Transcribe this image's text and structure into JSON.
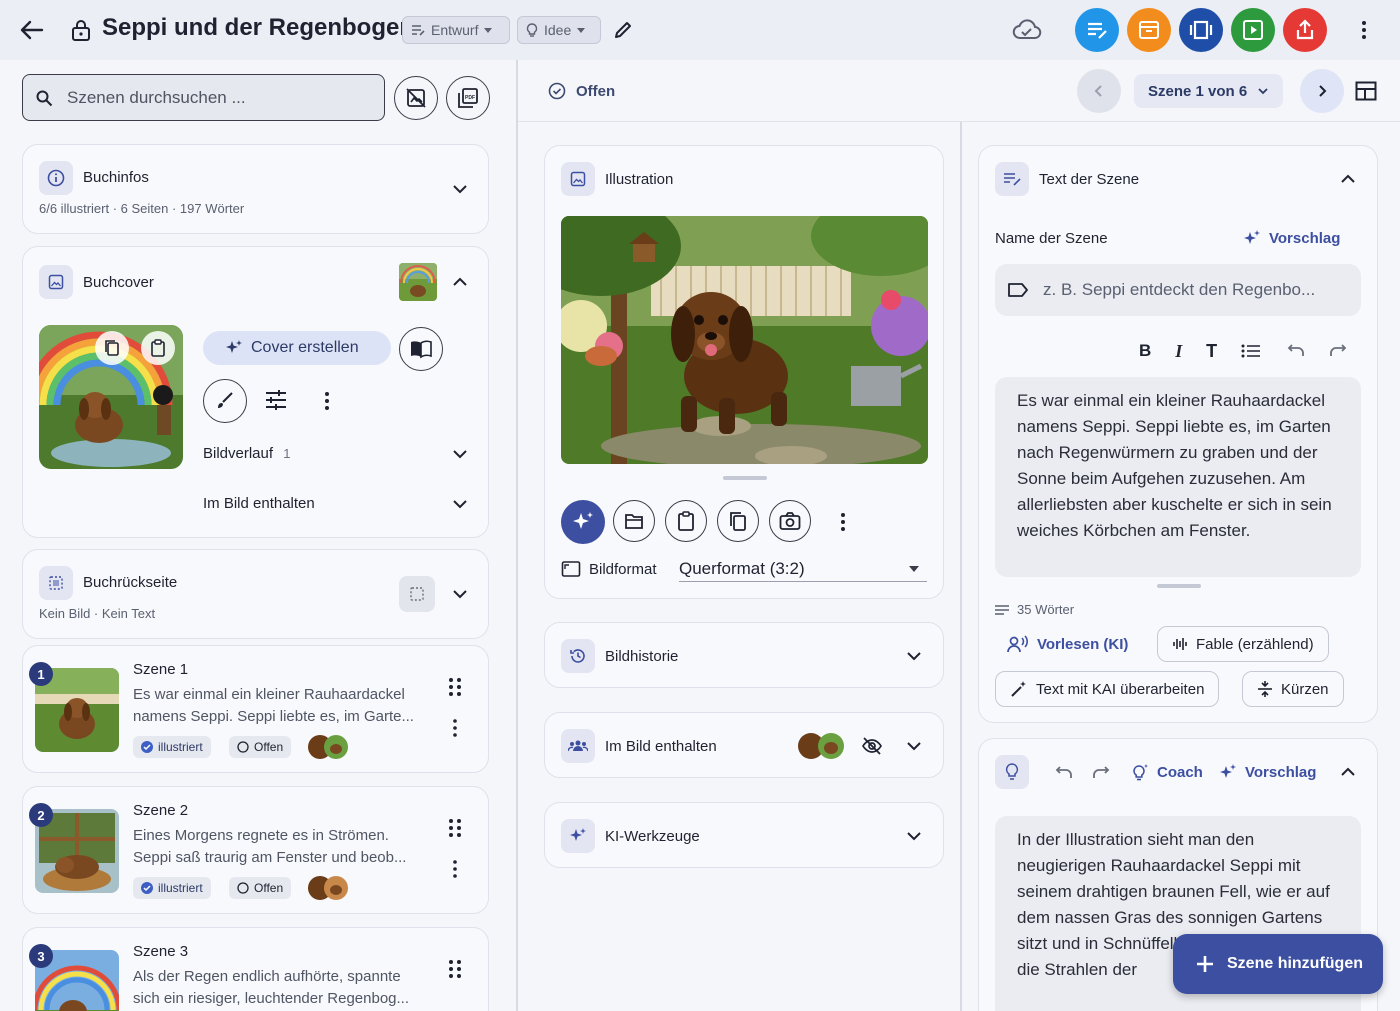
{
  "header": {
    "title": "Seppi und der Regenbogen",
    "status_chip": "Entwurf",
    "idea_chip": "Idee",
    "action_colors": [
      "#2196e8",
      "#f28c1c",
      "#1e4ea8",
      "#2e9a3e",
      "#e53935"
    ]
  },
  "left": {
    "search_placeholder": "Szenen durchsuchen ...",
    "bookinfo": {
      "title": "Buchinfos",
      "subtitle": "6/6 illustriert · 6 Seiten · 197 Wörter"
    },
    "cover": {
      "title": "Buchcover",
      "create_button": "Cover erstellen",
      "history_label": "Bildverlauf",
      "history_count": "1",
      "contained_label": "Im Bild enthalten"
    },
    "backcover": {
      "title": "Buchrückseite",
      "subtitle": "Kein Bild · Kein Text"
    },
    "scenes": [
      {
        "number": "1",
        "title": "Szene 1",
        "text1": "Es war einmal ein kleiner Rauhaardackel",
        "text2": "namens Seppi. Seppi liebte es, im Garte...",
        "tag1": "illustriert",
        "tag2": "Offen"
      },
      {
        "number": "2",
        "title": "Szene 2",
        "text1": "Eines Morgens regnete es in Strömen.",
        "text2": "Seppi saß traurig am Fenster und beob...",
        "tag1": "illustriert",
        "tag2": "Offen"
      },
      {
        "number": "3",
        "title": "Szene 3",
        "text1": "Als der Regen endlich aufhörte, spannte",
        "text2": "sich ein riesiger, leuchtender Regenbog..."
      }
    ]
  },
  "middle": {
    "status": "Offen",
    "scene_select": "Szene 1 von 6",
    "illustration_title": "Illustration",
    "format_label": "Bildformat",
    "format_value": "Querformat (3:2)",
    "history_title": "Bildhistorie",
    "contained_title": "Im Bild enthalten",
    "tools_title": "KI-Werkzeuge"
  },
  "right": {
    "text_title": "Text der Szene",
    "name_label": "Name der Szene",
    "suggest_label": "Vorschlag",
    "name_placeholder": "z. B. Seppi entdeckt den Regenbo...",
    "scene_text": "Es war einmal ein kleiner Rauhaardackel namens Seppi. Seppi liebte es, im Garten nach Regenwürmern zu graben und der Sonne beim Aufgehen zuzusehen. Am allerliebsten aber kuschelte er sich in sein weiches Körbchen am Fenster.",
    "word_count": "35 Wörter",
    "read_aloud": "Vorlesen (KI)",
    "voice": "Fable (erzählend)",
    "rewrite": "Text mit KAI überarbeiten",
    "shorten": "Kürzen",
    "coach": "Coach",
    "suggest2": "Vorschlag",
    "coach_text": "In der Illustration sieht man den neugierigen Rauhaardackel Seppi mit seinem drahtigen braunen Fell, wie er auf dem nassen Gras des sonnigen Gartens sitzt und in Schnüffelbewegung während die Strahlen der",
    "fab": "Szene hinzufügen"
  }
}
